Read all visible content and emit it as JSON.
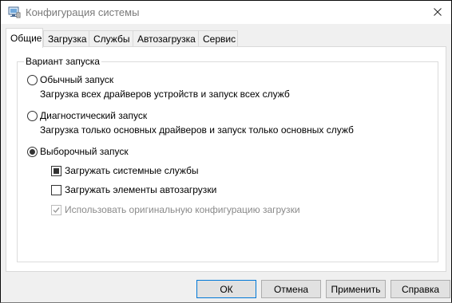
{
  "window": {
    "title": "Конфигурация системы",
    "app_icon": "msconfig-icon",
    "close_icon": "close-icon"
  },
  "tabs": [
    {
      "label": "Общие",
      "active": true
    },
    {
      "label": "Загрузка",
      "active": false
    },
    {
      "label": "Службы",
      "active": false
    },
    {
      "label": "Автозагрузка",
      "active": false
    },
    {
      "label": "Сервис",
      "active": false
    }
  ],
  "startup": {
    "group_label": "Вариант запуска",
    "options": [
      {
        "label": "Обычный запуск",
        "description": "Загрузка всех драйверов устройств и запуск всех служб",
        "selected": false
      },
      {
        "label": "Диагностический запуск",
        "description": "Загрузка только основных драйверов и запуск только основных служб",
        "selected": false
      },
      {
        "label": "Выборочный запуск",
        "selected": true
      }
    ],
    "selective": [
      {
        "label": "Загружать системные службы",
        "state": "indeterminate",
        "enabled": true
      },
      {
        "label": "Загружать элементы автозагрузки",
        "state": "unchecked",
        "enabled": true
      },
      {
        "label": "Использовать оригинальную конфигурацию загрузки",
        "state": "checked",
        "enabled": false
      }
    ]
  },
  "buttons": {
    "ok": "ОК",
    "cancel": "Отмена",
    "apply": "Применить",
    "help": "Справка"
  },
  "colors": {
    "accent": "#0078d7",
    "window_bg": "#f0f0f0",
    "panel_bg": "#ffffff",
    "disabled_text": "#8a8a8a"
  }
}
